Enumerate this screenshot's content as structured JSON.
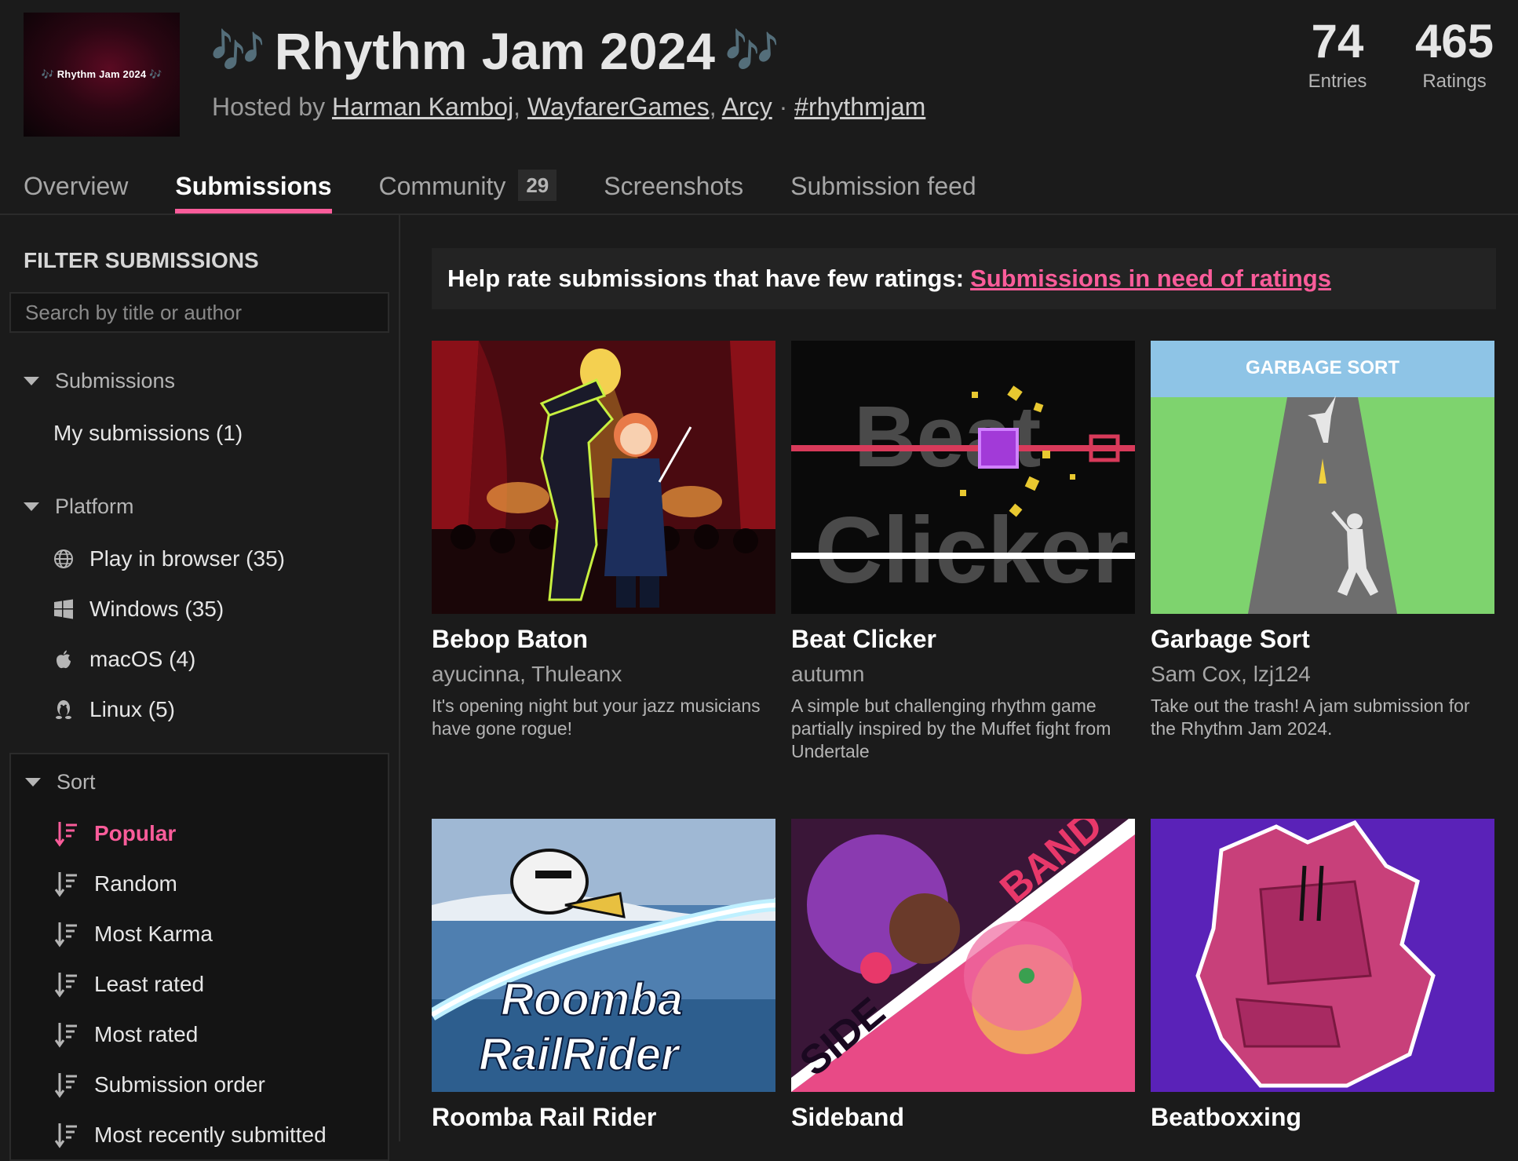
{
  "jam": {
    "banner_text": "🎶 Rhythm Jam 2024 🎶",
    "title": "Rhythm Jam 2024",
    "title_notes": "🎶",
    "hosted_prefix": "Hosted by",
    "hosts": [
      "Harman Kamboj",
      "WayfarerGames",
      "Arcy"
    ],
    "separator_comma": ",",
    "separator_dot": "·",
    "hashtag": "#rhythmjam"
  },
  "stats": {
    "entries": {
      "value": "74",
      "label": "Entries"
    },
    "ratings": {
      "value": "465",
      "label": "Ratings"
    }
  },
  "tabs": [
    {
      "label": "Overview",
      "active": false
    },
    {
      "label": "Submissions",
      "active": true
    },
    {
      "label": "Community",
      "count": "29",
      "active": false
    },
    {
      "label": "Screenshots",
      "active": false
    },
    {
      "label": "Submission feed",
      "active": false
    }
  ],
  "sidebar": {
    "heading": "FILTER SUBMISSIONS",
    "search_placeholder": "Search by title or author",
    "submissions": {
      "label": "Submissions",
      "items": [
        {
          "label": "My submissions (1)"
        }
      ]
    },
    "platform": {
      "label": "Platform",
      "items": [
        {
          "label": "Play in browser (35)",
          "icon": "globe-icon"
        },
        {
          "label": "Windows (35)",
          "icon": "windows-icon"
        },
        {
          "label": "macOS (4)",
          "icon": "apple-icon"
        },
        {
          "label": "Linux (5)",
          "icon": "linux-icon"
        }
      ]
    },
    "sort": {
      "label": "Sort",
      "items": [
        {
          "label": "Popular",
          "active": true
        },
        {
          "label": "Random"
        },
        {
          "label": "Most Karma"
        },
        {
          "label": "Least rated"
        },
        {
          "label": "Most rated"
        },
        {
          "label": "Submission order"
        },
        {
          "label": "Most recently submitted"
        }
      ]
    }
  },
  "help_banner": {
    "text": "Help rate submissions that have few ratings:",
    "link": "Submissions in need of ratings"
  },
  "submissions": [
    {
      "title": "Bebop Baton",
      "authors": "ayucinna, Thuleanx",
      "description": "It's opening night but your jazz musicians have gone rogue!"
    },
    {
      "title": "Beat Clicker",
      "authors": "autumn",
      "description": "A simple but challenging rhythm game partially inspired by the Muffet fight from Undertale",
      "thumb_text_1": "Beat",
      "thumb_text_2": "Clicker"
    },
    {
      "title": "Garbage Sort",
      "authors": "Sam Cox, lzj124",
      "description": "Take out the trash! A jam submission for the Rhythm Jam 2024.",
      "thumb_text": "GARBAGE SORT"
    },
    {
      "title": "Roomba Rail Rider",
      "thumb_text_1": "Roomba",
      "thumb_text_2": "RailRider"
    },
    {
      "title": "Sideband",
      "thumb_text_1": "SIDE",
      "thumb_text_2": "BAND"
    },
    {
      "title": "Beatboxxing"
    }
  ],
  "colors": {
    "accent": "#fa5c9a",
    "background": "#1b1b1b",
    "panel": "#141414"
  }
}
